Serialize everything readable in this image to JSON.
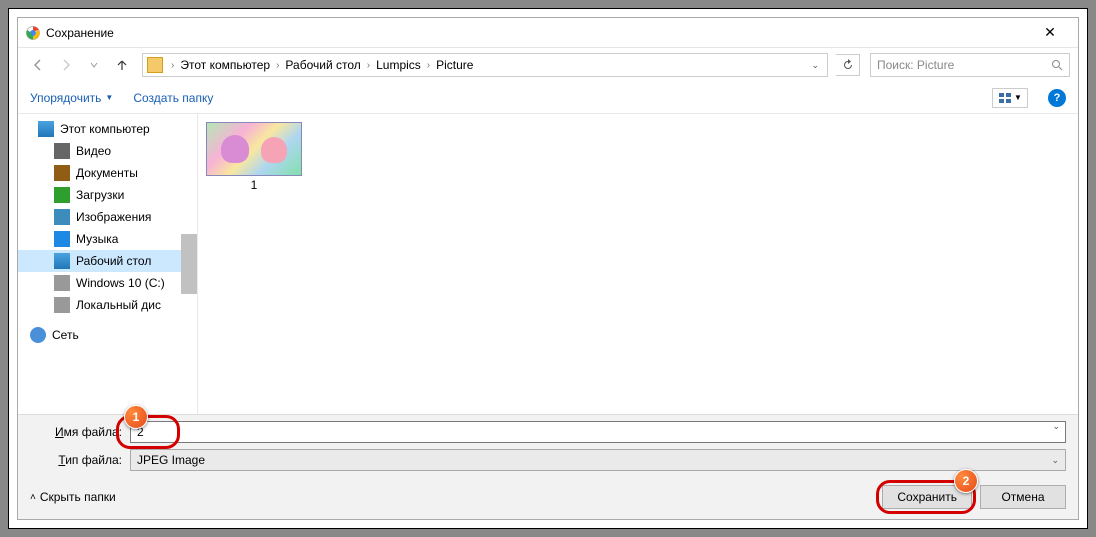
{
  "title": "Сохранение",
  "breadcrumb": [
    "Этот компьютер",
    "Рабочий стол",
    "Lumpics",
    "Picture"
  ],
  "search_placeholder": "Поиск: Picture",
  "toolbar": {
    "organize": "Упорядочить",
    "newfolder": "Создать папку"
  },
  "sidebar": {
    "pc": "Этот компьютер",
    "video": "Видео",
    "docs": "Документы",
    "downloads": "Загрузки",
    "images": "Изображения",
    "music": "Музыка",
    "desktop": "Рабочий стол",
    "drive_c": "Windows 10 (C:)",
    "drive_local": "Локальный дис",
    "network": "Сеть"
  },
  "thumb_label": "1",
  "filename_label": "Имя файла:",
  "filetype_label": "Тип файла:",
  "filename_value": "2",
  "filetype_value": "JPEG Image",
  "hide_folders": "Скрыть папки",
  "save_btn": "Сохранить",
  "cancel_btn": "Отмена",
  "badge1": "1",
  "badge2": "2"
}
